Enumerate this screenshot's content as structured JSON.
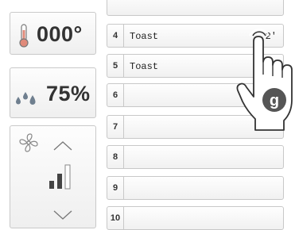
{
  "sensors": {
    "temperature": {
      "value": "000°",
      "icon": "thermometer-icon"
    },
    "humidity": {
      "value": "75%",
      "icon": "water-drops-icon"
    }
  },
  "fan": {
    "icon": "fan-icon",
    "up_icon": "chevron-up-icon",
    "down_icon": "chevron-down-icon",
    "level_icon": "signal-bars-icon",
    "level": 2,
    "max_level": 3
  },
  "steps": [
    {
      "number": "4",
      "name": "Toast",
      "time": "2'"
    },
    {
      "number": "5",
      "name": "Toast",
      "time": ""
    },
    {
      "number": "6",
      "name": "",
      "time": ""
    },
    {
      "number": "7",
      "name": "",
      "time": ""
    },
    {
      "number": "8",
      "name": "",
      "time": ""
    },
    {
      "number": "9",
      "name": "",
      "time": ""
    },
    {
      "number": "10",
      "name": "",
      "time": ""
    }
  ],
  "gesture": {
    "icon": "tap-hand-icon",
    "badge": "g"
  },
  "colors": {
    "text": "#333333",
    "border": "#c8c8c8",
    "badge": "#555555"
  }
}
